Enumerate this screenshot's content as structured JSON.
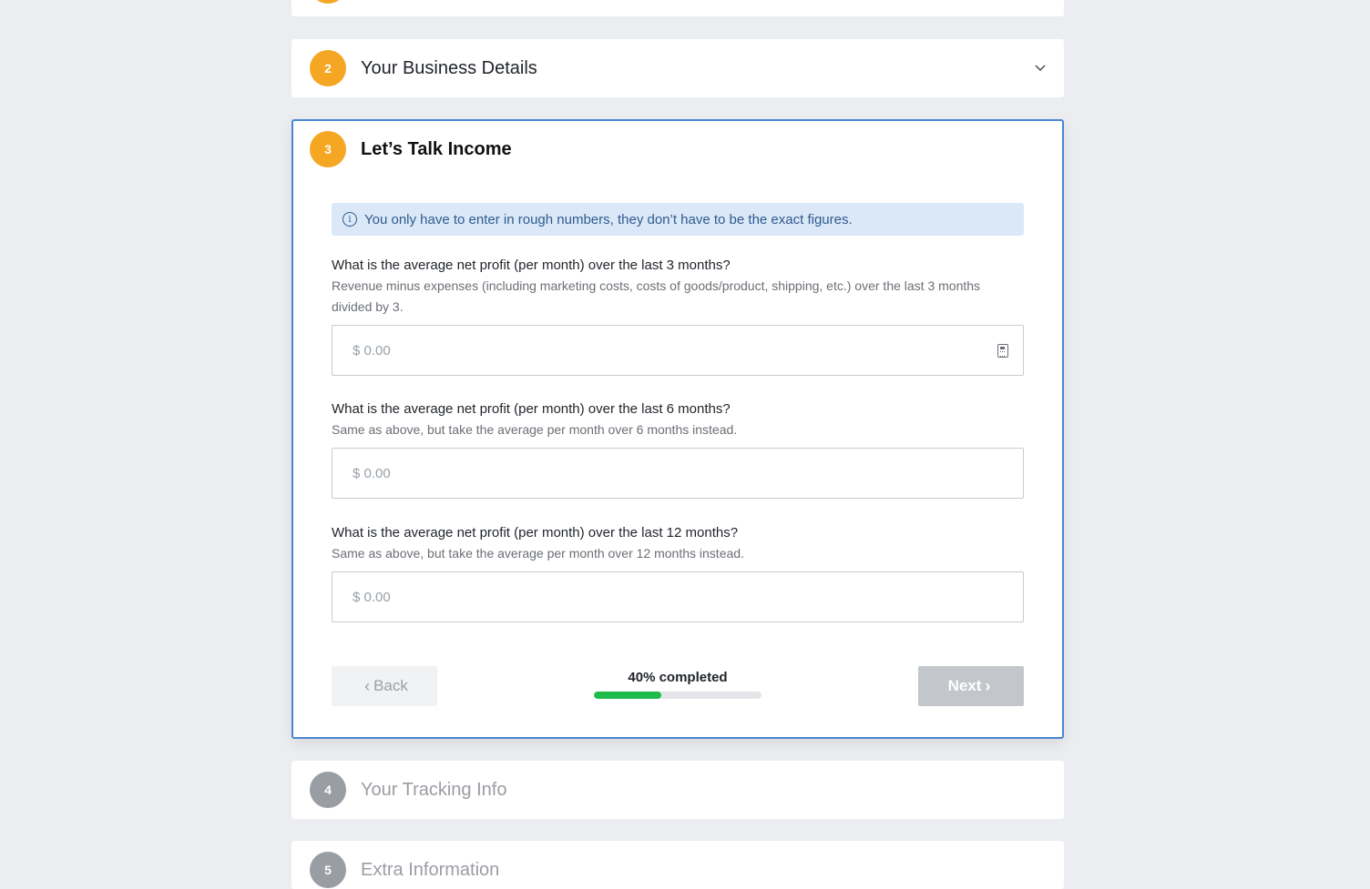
{
  "steps": {
    "step2": {
      "number": "2",
      "title": "Your Business Details"
    },
    "step3": {
      "number": "3",
      "title": "Let’s Talk Income"
    },
    "step4": {
      "number": "4",
      "title": "Your Tracking Info"
    },
    "step5": {
      "number": "5",
      "title": "Extra Information"
    }
  },
  "income": {
    "info": "You only have to enter in rough numbers, they don’t have to be the exact figures.",
    "questions": [
      {
        "label": "What is the average net profit (per month) over the last 3 months?",
        "help": "Revenue minus expenses (including marketing costs, costs of goods/product, shipping, etc.) over the last 3 months divided by 3.",
        "placeholder": "$ 0.00"
      },
      {
        "label": "What is the average net profit (per month) over the last 6 months?",
        "help": "Same as above, but take the average per month over 6 months instead.",
        "placeholder": "$ 0.00"
      },
      {
        "label": "What is the average net profit (per month) over the last 12 months?",
        "help": "Same as above, but take the average per month over 12 months instead.",
        "placeholder": "$ 0.00"
      }
    ],
    "back_label": "Back",
    "next_label": "Next",
    "progress_text": "40% completed",
    "progress_value": 0.4
  },
  "colors": {
    "accent_orange": "#f5a623",
    "active_border": "#4a86d4",
    "progress_green": "#1fbb4a",
    "inactive_grey": "#9a9da3"
  }
}
